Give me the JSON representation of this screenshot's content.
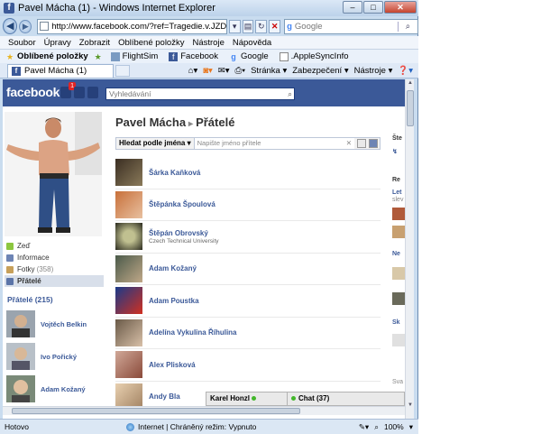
{
  "window": {
    "title": "Pavel Mácha (1) - Windows Internet Explorer",
    "buttons": {
      "minimize": "–",
      "maximize": "□",
      "close": "✕"
    }
  },
  "address": {
    "url": "http://www.facebook.com/?ref=Tragedie.v.JZD!!skv!",
    "search_placeholder": "Google"
  },
  "menu": [
    "Soubor",
    "Úpravy",
    "Zobrazit",
    "Oblíbené položky",
    "Nástroje",
    "Nápověda"
  ],
  "favorites": {
    "label": "Oblíbené položky",
    "links": [
      "FlightSim",
      "Facebook",
      "Google",
      ".AppleSyncInfo"
    ]
  },
  "tab": {
    "label": "Pavel Mácha (1)"
  },
  "commandbar": [
    "Stránka ▾",
    "Zabezpečení ▾",
    "Nástroje ▾"
  ],
  "facebook": {
    "logo": "facebook",
    "notification_count": "1",
    "search_placeholder": "Vyhledávání",
    "left_nav": [
      {
        "label": "Zeď",
        "icon": "wall-icon",
        "color": "#8cc63f"
      },
      {
        "label": "Informace",
        "icon": "info-icon",
        "color": "#6d84b4"
      },
      {
        "label": "Fotky",
        "count": "(358)",
        "icon": "photos-icon",
        "color": "#c7a05a"
      },
      {
        "label": "Přátelé",
        "icon": "friends-icon",
        "color": "#5b74a8",
        "selected": true
      }
    ],
    "friends_header": "Přátelé (215)",
    "left_friends": [
      "Vojtěch Belkin",
      "Ivo Pořický",
      "Adam Kožaný"
    ],
    "page_title": "Pavel Mácha",
    "page_subtitle": "Přátelé",
    "filter": {
      "dropdown": "Hledat podle jména",
      "placeholder": "Napište jméno přítele"
    },
    "friends": [
      {
        "name": "Šárka Kaňková",
        "sub": "",
        "color": "#6b5a3c"
      },
      {
        "name": "Štěpánka Špoulová",
        "sub": "",
        "color": "#b05a3a"
      },
      {
        "name": "Štěpán Obrovský",
        "sub": "Czech Technical University",
        "color": "#3c3c2a"
      },
      {
        "name": "Adam Kožaný",
        "sub": "",
        "color": "#5e6e5c"
      },
      {
        "name": "Adam Poustka",
        "sub": "",
        "color": "#c03a2a"
      },
      {
        "name": "Adelína Vykulina Říhulina",
        "sub": "",
        "color": "#8a7a68"
      },
      {
        "name": "Alex Plisková",
        "sub": "",
        "color": "#b07a6a"
      },
      {
        "name": "Andy Bla",
        "sub": "",
        "color": "#a89070"
      }
    ],
    "chat": {
      "contact": "Karel Honzl",
      "label": "Chat (37)"
    },
    "right_fragments": [
      "Šte",
      "Re",
      "Let",
      "slev",
      "Ne",
      "Sk",
      "Sva",
      "TO"
    ]
  },
  "status": {
    "left": "Hotovo",
    "zone": "Internet | Chráněný režim: Vypnuto",
    "zoom": "100%"
  }
}
